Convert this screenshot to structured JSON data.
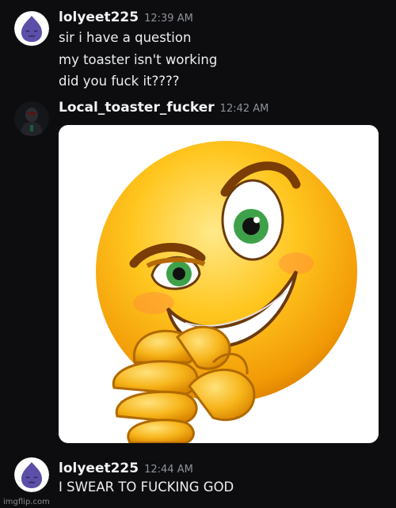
{
  "messages": [
    {
      "username": "lolyeet225",
      "time": "12:39 AM",
      "avatar_icon": "purple-blob-avatar-icon",
      "lines": [
        "sir i have a question",
        "my toaster isn't working",
        "did you fuck it????"
      ]
    },
    {
      "username": "Local_toaster_fucker",
      "time": "12:42 AM",
      "avatar_icon": "dark-figure-avatar-icon",
      "attachment_icon": "smirking-emoji-icon"
    },
    {
      "username": "lolyeet225",
      "time": "12:44 AM",
      "avatar_icon": "purple-blob-avatar-icon",
      "lines": [
        "I SWEAR TO FUCKING GOD"
      ]
    }
  ],
  "watermark": "imgflip.com",
  "colors": {
    "background": "#0d0d10",
    "text": "#f2f3f5",
    "timestamp": "#8e9297",
    "avatar_purple": "#5b4fa8"
  }
}
